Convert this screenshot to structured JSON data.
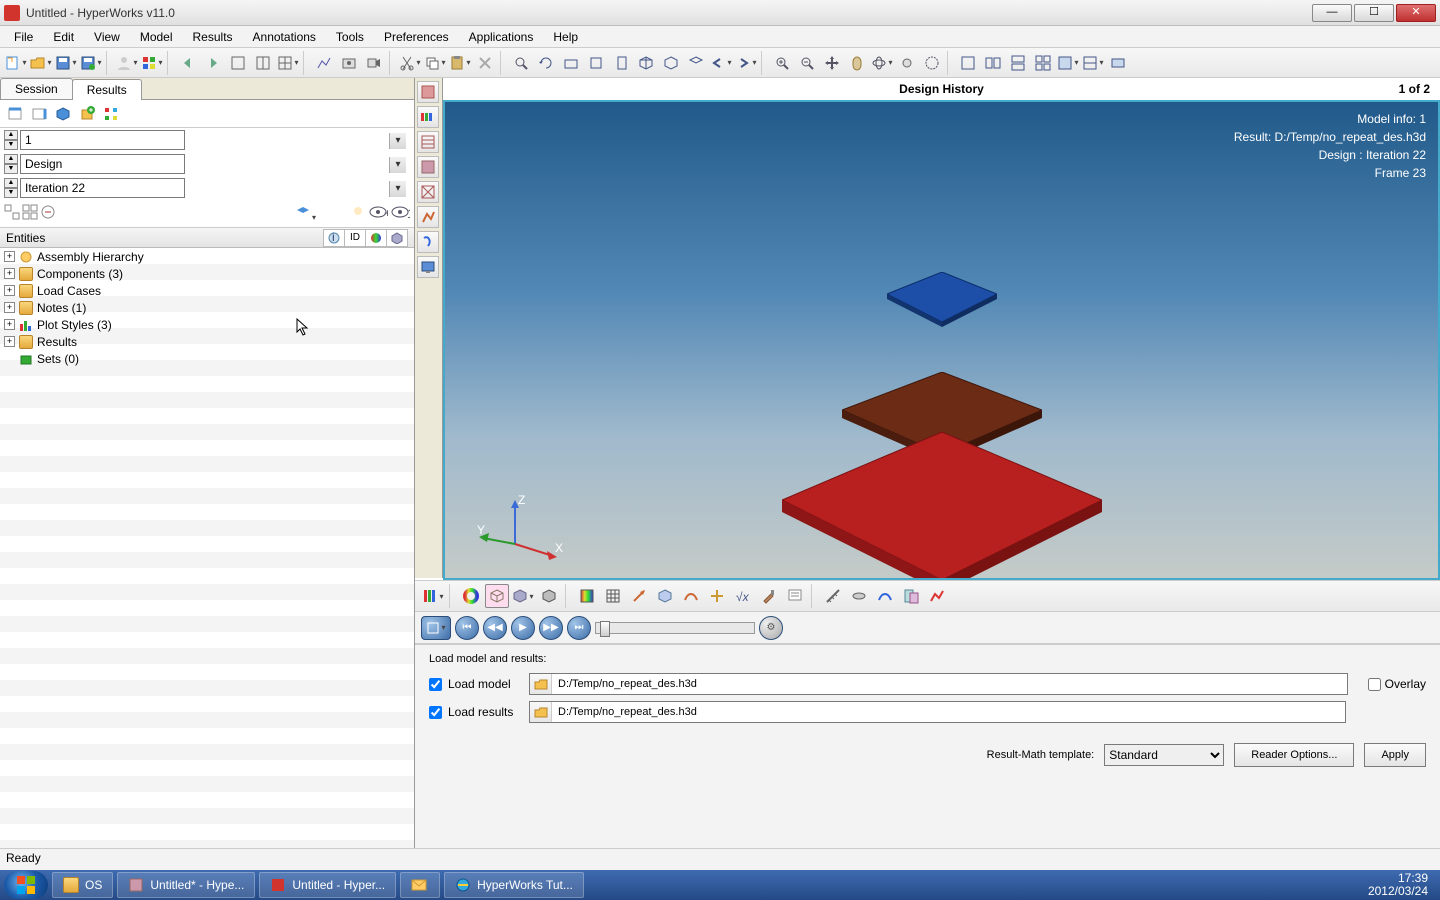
{
  "window": {
    "title": "Untitled - HyperWorks v11.0"
  },
  "menu": [
    "File",
    "Edit",
    "View",
    "Model",
    "Results",
    "Annotations",
    "Tools",
    "Preferences",
    "Applications",
    "Help"
  ],
  "left": {
    "tabs": {
      "session": "Session",
      "results": "Results"
    },
    "combo1": "1",
    "combo2": "Design",
    "combo3": "Iteration 22",
    "entities_header": "Entities",
    "col_id": "ID",
    "tree": {
      "assembly": "Assembly Hierarchy",
      "components": "Components (3)",
      "loadcases": "Load Cases",
      "notes": "Notes (1)",
      "plotstyles": "Plot Styles (3)",
      "results": "Results",
      "sets": "Sets  (0)"
    }
  },
  "viewport": {
    "title": "Design History",
    "page_indicator": "1 of 2",
    "info1": "Model info: 1",
    "info2": "Result: D:/Temp/no_repeat_des.h3d",
    "info3": "Design : Iteration 22",
    "info4": "Frame 23",
    "axis_x": "X",
    "axis_y": "Y",
    "axis_z": "Z"
  },
  "load_panel": {
    "heading": "Load model and results:",
    "load_model_label": "Load model",
    "load_results_label": "Load results",
    "model_path": "D:/Temp/no_repeat_des.h3d",
    "results_path": "D:/Temp/no_repeat_des.h3d",
    "overlay_label": "Overlay",
    "template_label": "Result-Math template:",
    "template_value": "Standard",
    "reader_btn": "Reader Options...",
    "apply_btn": "Apply"
  },
  "statusbar": {
    "text": "Ready"
  },
  "taskbar": {
    "items": [
      {
        "label": "OS"
      },
      {
        "label": "Untitled* - Hype..."
      },
      {
        "label": "Untitled - Hyper..."
      },
      {
        "label": ""
      },
      {
        "label": "HyperWorks Tut..."
      }
    ],
    "time": "17:39",
    "date": "2012/03/24"
  }
}
